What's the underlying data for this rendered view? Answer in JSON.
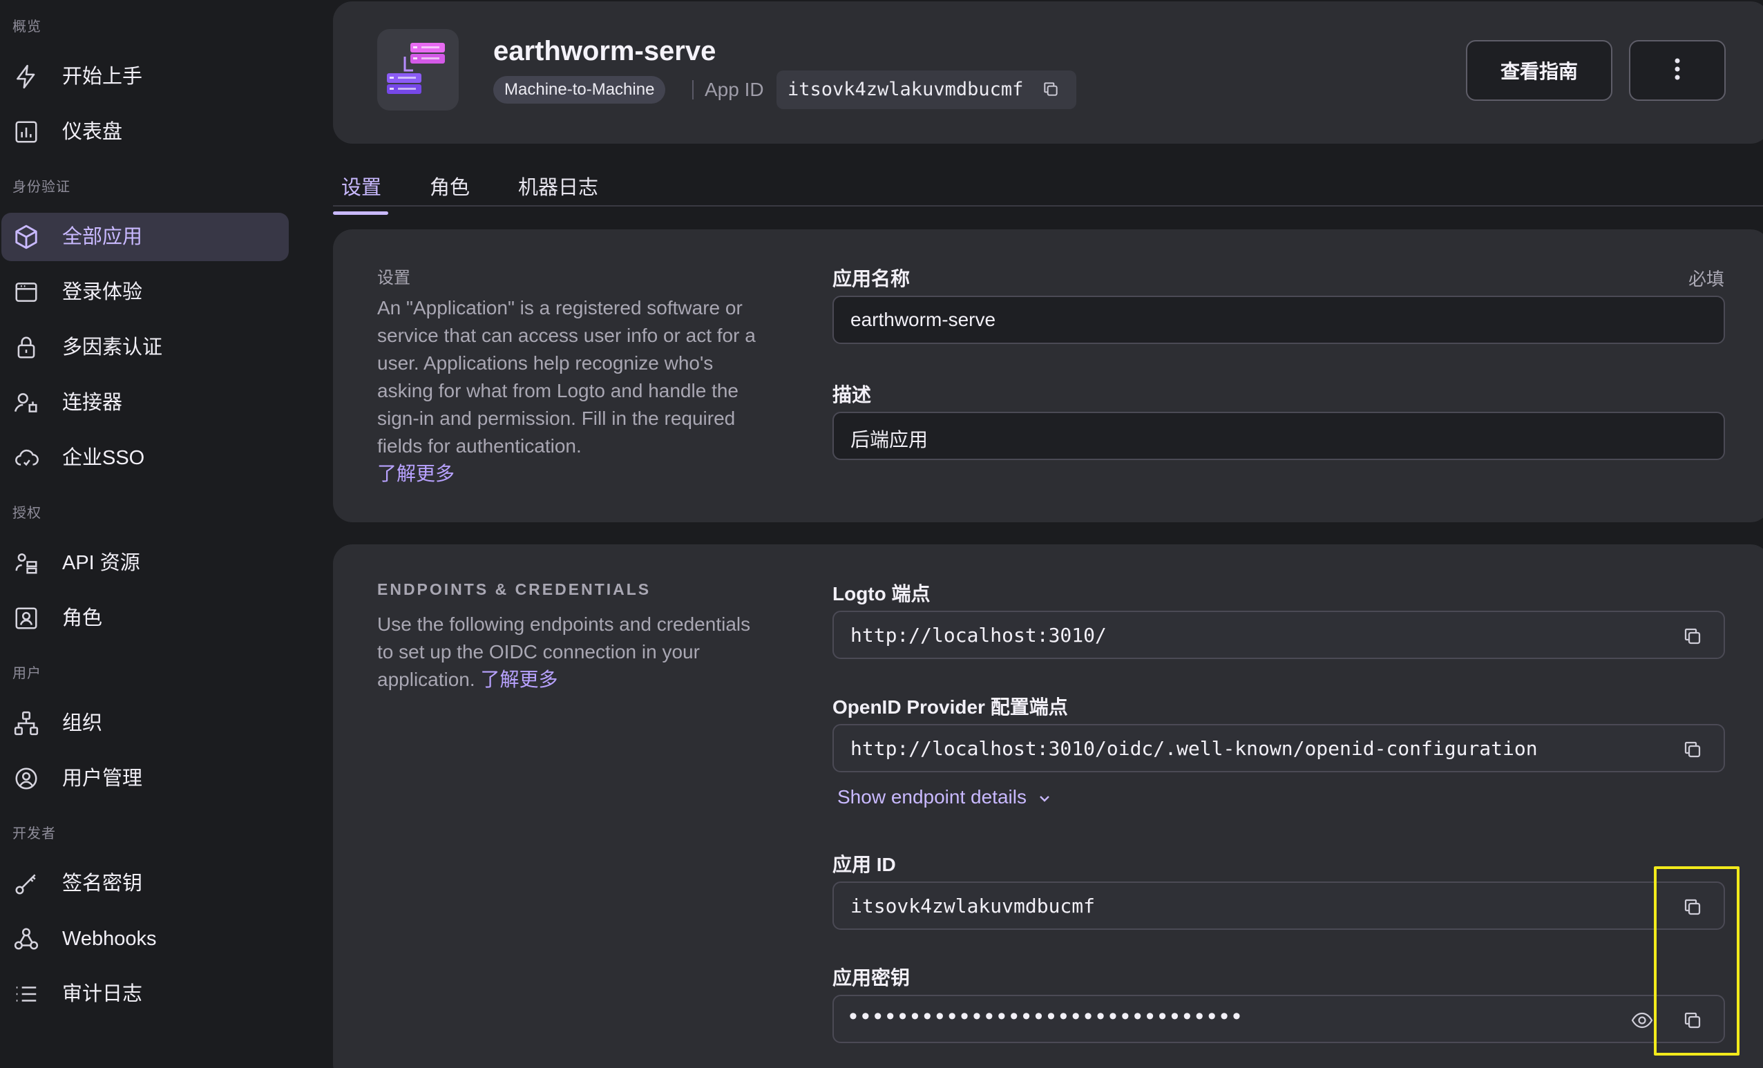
{
  "sidebar": {
    "sections": {
      "overview": "概览",
      "auth": "身份验证",
      "authz": "授权",
      "users": "用户",
      "developer": "开发者"
    },
    "items": [
      {
        "label": "开始上手",
        "icon": "bolt-icon"
      },
      {
        "label": "仪表盘",
        "icon": "chart-icon"
      },
      {
        "label": "全部应用",
        "icon": "cube-icon",
        "active": true
      },
      {
        "label": "登录体验",
        "icon": "browser-icon"
      },
      {
        "label": "多因素认证",
        "icon": "lock-icon"
      },
      {
        "label": "连接器",
        "icon": "connector-icon"
      },
      {
        "label": "企业SSO",
        "icon": "cloud-icon"
      },
      {
        "label": "API 资源",
        "icon": "api-icon"
      },
      {
        "label": "角色",
        "icon": "role-icon"
      },
      {
        "label": "组织",
        "icon": "org-icon"
      },
      {
        "label": "用户管理",
        "icon": "user-icon"
      },
      {
        "label": "签名密钥",
        "icon": "key-icon"
      },
      {
        "label": "Webhooks",
        "icon": "webhook-icon"
      },
      {
        "label": "审计日志",
        "icon": "list-icon"
      }
    ]
  },
  "header": {
    "app_name": "earthworm-serve",
    "type_badge": "Machine-to-Machine",
    "app_id_label": "App ID",
    "app_id_value": "itsovk4zwlakuvmdbucmf",
    "guide_button": "查看指南"
  },
  "tabs": [
    "设置",
    "角色",
    "机器日志"
  ],
  "settings_card": {
    "title": "设置",
    "description": "An \"Application\" is a registered software or service that can access user info or act for a user. Applications help recognize who's asking for what from Logto and handle the sign-in and permission. Fill in the required fields for authentication.",
    "learn_more": "了解更多",
    "name_label": "应用名称",
    "required_note": "必填",
    "name_value": "earthworm-serve",
    "desc_label": "描述",
    "desc_value": "后端应用"
  },
  "endpoints_card": {
    "title": "ENDPOINTS & CREDENTIALS",
    "description": "Use the following endpoints and credentials to set up the OIDC connection in your application.",
    "learn_more": "了解更多",
    "logto_endpoint_label": "Logto 端点",
    "logto_endpoint_value": "http://localhost:3010/",
    "oidc_label": "OpenID Provider 配置端点",
    "oidc_value": "http://localhost:3010/oidc/.well-known/openid-configuration",
    "show_details": "Show endpoint details",
    "app_id_label": "应用 ID",
    "app_id_value": "itsovk4zwlakuvmdbucmf",
    "secret_label": "应用密钥",
    "secret_value": "••••••••••••••••••••••••••••••••"
  },
  "colors": {
    "accent": "#c9b9ff",
    "highlight": "#f2ea1c",
    "card": "#2d2e33",
    "background": "#1b1c1f"
  }
}
